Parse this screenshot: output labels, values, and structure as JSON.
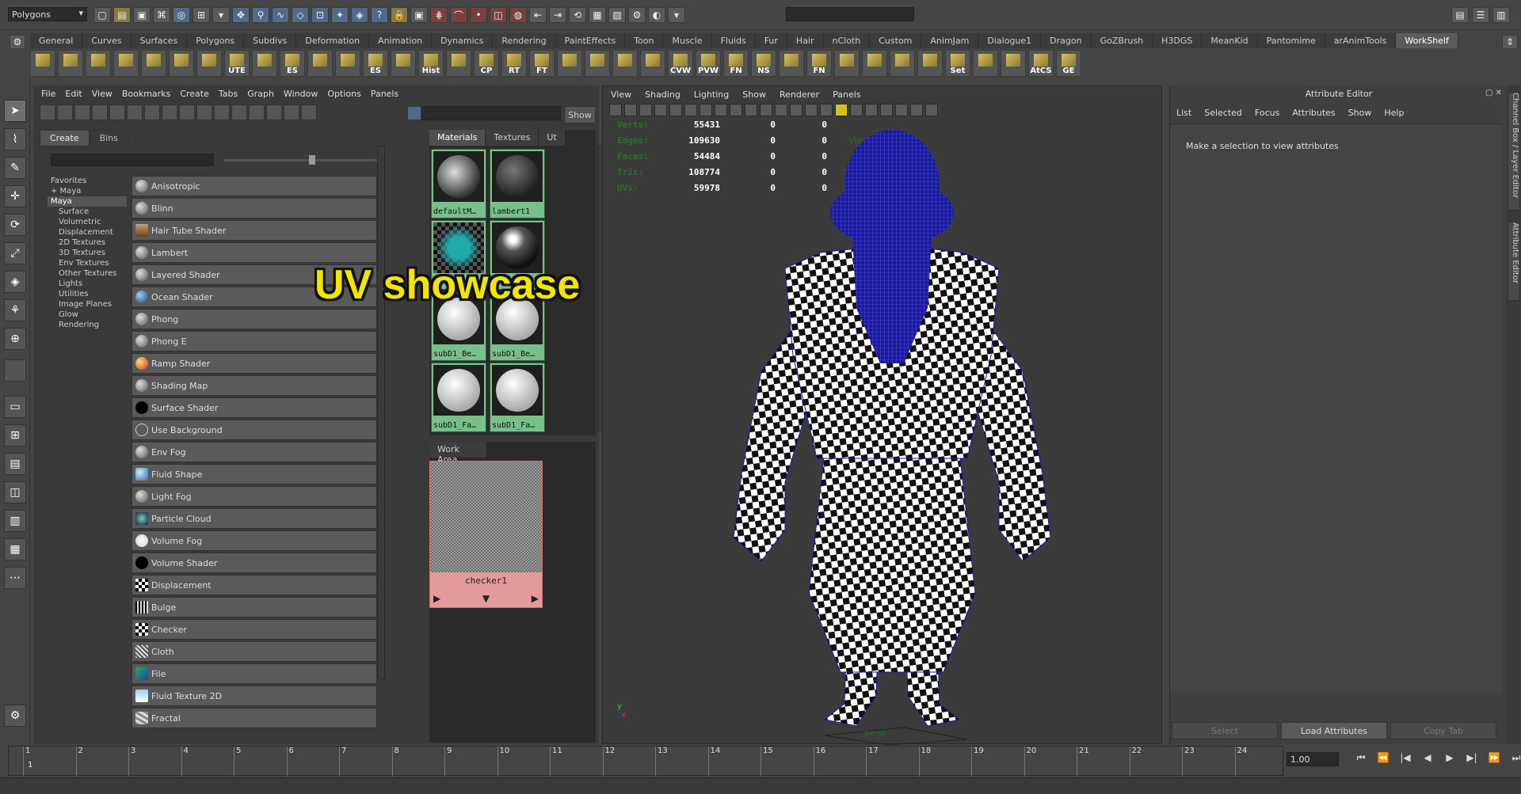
{
  "top": {
    "mode_selector": "Polygons"
  },
  "shelf_tabs": [
    "General",
    "Curves",
    "Surfaces",
    "Polygons",
    "Subdivs",
    "Deformation",
    "Animation",
    "Dynamics",
    "Rendering",
    "PaintEffects",
    "Toon",
    "Muscle",
    "Fluids",
    "Fur",
    "Hair",
    "nCloth",
    "Custom",
    "AnimJam",
    "Dialogue1",
    "Dragon",
    "GoZBrush",
    "H3DGS",
    "MeanKid",
    "Pantomime",
    "arAnimTools",
    "WorkShelf"
  ],
  "shelf_active": "WorkShelf",
  "shelf_buttons": [
    "",
    "",
    "",
    "",
    "",
    "",
    "",
    "UTE",
    "",
    "ES",
    "",
    "",
    "ES",
    "",
    "Hist",
    "",
    "CP",
    "RT",
    "FT",
    "",
    "",
    "",
    "",
    "CVW",
    "PVW",
    "FN",
    "NS",
    "",
    "FN",
    "",
    "",
    "",
    "",
    "Set",
    "",
    "",
    "AtCS",
    "GE"
  ],
  "hypershade": {
    "menu": [
      "File",
      "Edit",
      "View",
      "Bookmarks",
      "Create",
      "Tabs",
      "Graph",
      "Window",
      "Options",
      "Panels"
    ],
    "show_button": "Show",
    "create_tabs": [
      "Create",
      "Bins"
    ],
    "tree": [
      "Favorites",
      "+ Maya",
      "Maya",
      "Surface",
      "Volumetric",
      "Displacement",
      "2D Textures",
      "3D Textures",
      "Env Textures",
      "Other Textures",
      "Lights",
      "Utilities",
      "Image Planes",
      "Glow",
      "Rendering"
    ],
    "nodes": [
      {
        "label": "Anisotropic",
        "swatch": "sphere-grey"
      },
      {
        "label": "Blinn",
        "swatch": "sphere-grey"
      },
      {
        "label": "Hair Tube Shader",
        "swatch": "hair"
      },
      {
        "label": "Lambert",
        "swatch": "sphere-grey"
      },
      {
        "label": "Layered Shader",
        "swatch": "sphere-grey"
      },
      {
        "label": "Ocean Shader",
        "swatch": "ocean"
      },
      {
        "label": "Phong",
        "swatch": "sphere-grey"
      },
      {
        "label": "Phong E",
        "swatch": "sphere-grey"
      },
      {
        "label": "Ramp Shader",
        "swatch": "ramp"
      },
      {
        "label": "Shading Map",
        "swatch": "sphere-grey"
      },
      {
        "label": "Surface Shader",
        "swatch": "black"
      },
      {
        "label": "Use Background",
        "swatch": "outline"
      },
      {
        "label": "Env Fog",
        "swatch": "sphere-grey"
      },
      {
        "label": "Fluid Shape",
        "swatch": "fluid"
      },
      {
        "label": "Light Fog",
        "swatch": "sphere-grey"
      },
      {
        "label": "Particle Cloud",
        "swatch": "particle"
      },
      {
        "label": "Volume Fog",
        "swatch": "white"
      },
      {
        "label": "Volume Shader",
        "swatch": "black"
      },
      {
        "label": "Displacement",
        "swatch": "checker"
      },
      {
        "label": "Bulge",
        "swatch": "bulge"
      },
      {
        "label": "Checker",
        "swatch": "checker"
      },
      {
        "label": "Cloth",
        "swatch": "cloth"
      },
      {
        "label": "File",
        "swatch": "file"
      },
      {
        "label": "Fluid Texture 2D",
        "swatch": "fluid2d"
      },
      {
        "label": "Fractal",
        "swatch": "fractal"
      }
    ],
    "material_tabs": [
      "Materials",
      "Textures",
      "Ut"
    ],
    "materials": [
      {
        "label": "defaultM…"
      },
      {
        "label": "lambert1"
      },
      {
        "label": ""
      },
      {
        "label": ""
      },
      {
        "label": "subD1_Be…"
      },
      {
        "label": "subD1_Be…"
      },
      {
        "label": "subD1_Fa…"
      },
      {
        "label": "subD1_Fa…"
      }
    ],
    "work_area_tab": "Work Area",
    "work_node": "checker1"
  },
  "overlay_title": "UV showcase",
  "viewport": {
    "menu": [
      "View",
      "Shading",
      "Lighting",
      "Show",
      "Renderer",
      "Panels"
    ],
    "hud": [
      {
        "label": "Verts:",
        "a": "55431",
        "b": "0",
        "c": "0"
      },
      {
        "label": "Edges:",
        "a": "109630",
        "b": "0",
        "c": "0"
      },
      {
        "label": "Faces:",
        "a": "54484",
        "b": "0",
        "c": "0"
      },
      {
        "label": "Tris:",
        "a": "108774",
        "b": "0",
        "c": "0"
      },
      {
        "label": "UVs:",
        "a": "59978",
        "b": "0",
        "c": "0"
      }
    ],
    "backface_label": "Viewport 2.0",
    "camera_label": "persp"
  },
  "attribute_editor": {
    "title": "Attribute Editor",
    "menu": [
      "List",
      "Selected",
      "Focus",
      "Attributes",
      "Show",
      "Help"
    ],
    "message": "Make a selection to view attributes",
    "buttons": [
      "Select",
      "Load Attributes",
      "Copy Tab"
    ]
  },
  "side_tabs": [
    "Channel Box / Layer Editor",
    "Attribute Editor"
  ],
  "timeline": {
    "ticks": [
      "1",
      "2",
      "3",
      "4",
      "5",
      "6",
      "7",
      "8",
      "9",
      "10",
      "11",
      "12",
      "13",
      "14",
      "15",
      "16",
      "17",
      "18",
      "19",
      "20",
      "21",
      "22",
      "23",
      "24"
    ],
    "current_frame": "1",
    "frame_field": "1.00"
  },
  "colors": {
    "accent": "#78c08a",
    "overlay_yellow": "#f2e600",
    "mesh_blue": "#1a1aa0"
  }
}
